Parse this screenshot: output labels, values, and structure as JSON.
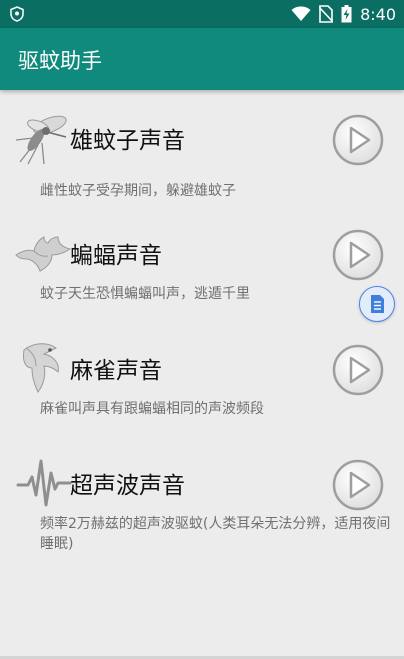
{
  "status_bar": {
    "time": "8:40",
    "icons": [
      "shield-icon",
      "wifi-icon",
      "no-sim-icon",
      "battery-charging-icon"
    ],
    "color": "#0a6e63"
  },
  "app_bar": {
    "title": "驱蚊助手",
    "color": "#0f8a7c"
  },
  "items": [
    {
      "icon": "mosquito-icon",
      "title": "雄蚊子声音",
      "description": "雌性蚊子受孕期间，躲避雄蚊子",
      "action_icon": "play-icon"
    },
    {
      "icon": "bat-icon",
      "title": "蝙蝠声音",
      "description": "蚊子天生恐惧蝙蝠叫声，逃遁千里",
      "action_icon": "play-icon"
    },
    {
      "icon": "sparrow-icon",
      "title": "麻雀声音",
      "description": "麻雀叫声具有跟蝙蝠相同的声波频段",
      "action_icon": "play-icon"
    },
    {
      "icon": "waveform-icon",
      "title": "超声波声音",
      "description": "频率2万赫兹的超声波驱蚊(人类耳朵无法分辨，适用夜间睡眠)",
      "action_icon": "play-icon"
    }
  ],
  "floating_button": {
    "icon": "document-icon"
  }
}
